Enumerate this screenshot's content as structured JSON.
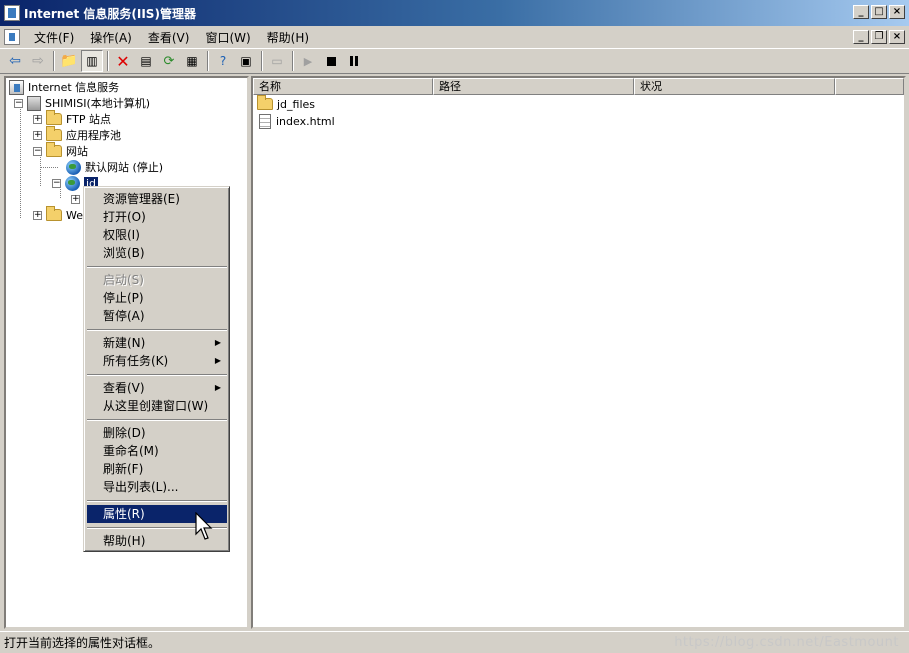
{
  "window": {
    "title": "Internet 信息服务(IIS)管理器"
  },
  "menubar": {
    "items": [
      "文件(F)",
      "操作(A)",
      "查看(V)",
      "窗口(W)",
      "帮助(H)"
    ]
  },
  "toolbar": {
    "buttons": [
      "back-icon",
      "forward-icon",
      "up-folder-icon",
      "show-tree-icon",
      "delete-icon",
      "properties-icon",
      "refresh-icon",
      "export-list-icon",
      "help-icon",
      "console-icon",
      "computer-icon",
      "start-icon",
      "stop-icon",
      "pause-icon"
    ]
  },
  "tree": {
    "root": "Internet 信息服务",
    "server": "SHIMISI(本地计算机)",
    "ftp": "FTP 站点",
    "app_pools": "应用程序池",
    "websites": "网站",
    "default_site": "默认网站 (停止)",
    "jd": "jd",
    "web_ext": "Web"
  },
  "list": {
    "columns": [
      "名称",
      "路径",
      "状况"
    ],
    "rows": [
      {
        "name": "jd_files",
        "icon": "folder-icon"
      },
      {
        "name": "index.html",
        "icon": "file-icon"
      }
    ]
  },
  "context_menu": {
    "items": [
      {
        "label": "资源管理器(E)",
        "disabled": false
      },
      {
        "label": "打开(O)",
        "disabled": false
      },
      {
        "label": "权限(I)",
        "disabled": false
      },
      {
        "label": "浏览(B)",
        "disabled": false
      },
      {
        "label": "启动(S)",
        "disabled": true
      },
      {
        "label": "停止(P)",
        "disabled": false
      },
      {
        "label": "暂停(A)",
        "disabled": false
      },
      {
        "label": "新建(N)",
        "disabled": false,
        "submenu": true
      },
      {
        "label": "所有任务(K)",
        "disabled": false,
        "submenu": true
      },
      {
        "label": "查看(V)",
        "disabled": false,
        "submenu": true
      },
      {
        "label": "从这里创建窗口(W)",
        "disabled": false
      },
      {
        "label": "删除(D)",
        "disabled": false
      },
      {
        "label": "重命名(M)",
        "disabled": false
      },
      {
        "label": "刷新(F)",
        "disabled": false
      },
      {
        "label": "导出列表(L)...",
        "disabled": false
      },
      {
        "label": "属性(R)",
        "disabled": false,
        "highlighted": true
      },
      {
        "label": "帮助(H)",
        "disabled": false
      }
    ]
  },
  "statusbar": {
    "text": "打开当前选择的属性对话框。",
    "watermark": "https://blog.csdn.net/Eastmount"
  }
}
